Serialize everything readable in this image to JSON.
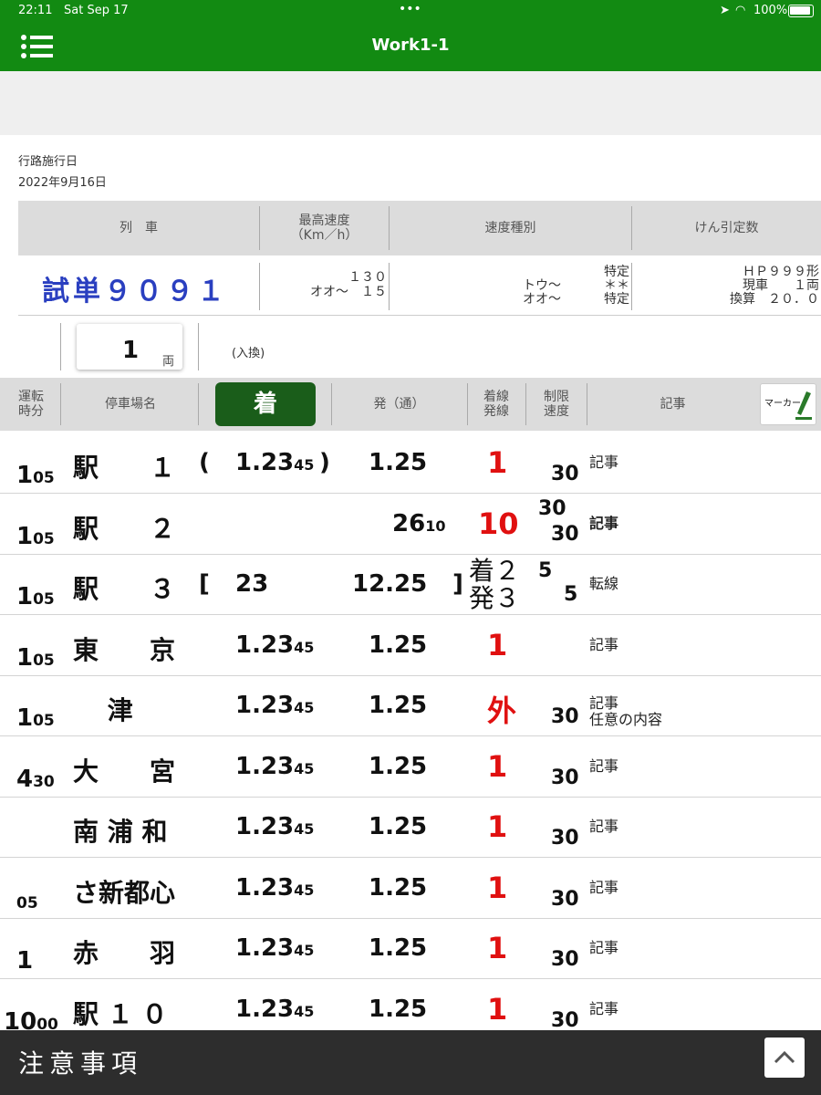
{
  "status": {
    "time": "22:11",
    "date": "Sat Sep 17",
    "dots": "•••",
    "battery": "100%"
  },
  "nav": {
    "title": "Work1-1"
  },
  "date_label": "行路施行日",
  "date_value": "2022年9月16日",
  "info_header": {
    "train": "列　車",
    "max_speed_1": "最高速度",
    "max_speed_2": "（Km／h）",
    "speed_type": "速度種別",
    "tonnage": "けん引定数"
  },
  "info": {
    "train_name": "試単９０９１",
    "max_speed_a": "１３０",
    "max_speed_b": "オオ〜　１５",
    "speed_left_a": "トウ〜",
    "speed_left_b": "オオ〜",
    "speed_right_a": "特定",
    "speed_right_b": "＊＊",
    "speed_right_c": "特定",
    "ton_a": "ＨＰ９９９形",
    "ton_b": "現車　　１両",
    "ton_c": "換算　２０．０"
  },
  "cars": {
    "count": "1",
    "unit": "両",
    "note": "(入換)"
  },
  "list_header": {
    "run_time_1": "運転",
    "run_time_2": "時分",
    "station": "停車場名",
    "arrive": "着",
    "depart": "発（通）",
    "track_1": "着線",
    "track_2": "発線",
    "limit_1": "制限",
    "limit_2": "速度",
    "note": "記事",
    "marker": "マーカー"
  },
  "rows": [
    {
      "tm": "1",
      "ts": "05",
      "st": "駅　　１",
      "ab": "(",
      "am": "1.23",
      "as": "45",
      "ae": ")",
      "dm": "1.25",
      "ds": "",
      "tr": "1",
      "sp": "30",
      "sp2": "",
      "n1": "記事",
      "n2": ""
    },
    {
      "tm": "1",
      "ts": "05",
      "st": "駅　　２",
      "ab": "",
      "am": "",
      "as": "",
      "ae": "",
      "dm": "26",
      "ds": "10",
      "tr": "10",
      "sp": "30",
      "sp2": "30",
      "n1": "記事",
      "n2": ""
    },
    {
      "tm": "1",
      "ts": "05",
      "st": "駅　　３",
      "ab": "[",
      "am": "23",
      "as": "",
      "ae": "",
      "dm": "12.25",
      "ds": "",
      "dend": "]",
      "tr": "",
      "tr_a": "着２",
      "tr_b": "発３",
      "sp": "5",
      "sp2": "5",
      "n1": "転線",
      "n2": ""
    },
    {
      "tm": "1",
      "ts": "05",
      "st": "東　　京",
      "ab": "",
      "am": "1.23",
      "as": "45",
      "ae": "",
      "dm": "1.25",
      "ds": "",
      "tr": "1",
      "sp": "",
      "sp2": "",
      "n1": "記事",
      "n2": ""
    },
    {
      "tm": "1",
      "ts": "05",
      "st": "　 津",
      "ab": "",
      "am": "1.23",
      "as": "45",
      "ae": "",
      "dm": "1.25",
      "ds": "",
      "tr": "外",
      "sp": "30",
      "sp2": "",
      "n1": "記事",
      "n2": "任意の内容"
    },
    {
      "tm": "4",
      "ts": "30",
      "st": "大　　宮",
      "ab": "",
      "am": "1.23",
      "as": "45",
      "ae": "",
      "dm": "1.25",
      "ds": "",
      "tr": "1",
      "sp": "30",
      "sp2": "",
      "n1": "記事",
      "n2": ""
    },
    {
      "tm": "",
      "ts": "",
      "st": "南 浦 和",
      "ab": "",
      "am": "1.23",
      "as": "45",
      "ae": "",
      "dm": "1.25",
      "ds": "",
      "tr": "1",
      "sp": "30",
      "sp2": "",
      "n1": "記事",
      "n2": ""
    },
    {
      "tm": "",
      "ts": "05",
      "st": "さ新都心",
      "ab": "",
      "am": "1.23",
      "as": "45",
      "ae": "",
      "dm": "1.25",
      "ds": "",
      "tr": "1",
      "sp": "30",
      "sp2": "",
      "n1": "記事",
      "n2": ""
    },
    {
      "tm": "1",
      "ts": "",
      "st": "赤　　羽",
      "ab": "",
      "am": "1.23",
      "as": "45",
      "ae": "",
      "dm": "1.25",
      "ds": "",
      "tr": "1",
      "sp": "30",
      "sp2": "",
      "n1": "記事",
      "n2": ""
    },
    {
      "tm": "10",
      "ts": "00",
      "st": "駅 １ ０",
      "ab": "",
      "am": "1.23",
      "as": "45",
      "ae": "",
      "dm": "1.25",
      "ds": "",
      "tr": "1",
      "sp": "30",
      "sp2": "",
      "n1": "記事",
      "n2": ""
    }
  ],
  "footer": {
    "title": "注意事項"
  },
  "colors": {
    "green": "#128a12",
    "dark_green": "#1a5d1a",
    "track_red": "#e01010",
    "train_blue": "#2a3fc0"
  }
}
